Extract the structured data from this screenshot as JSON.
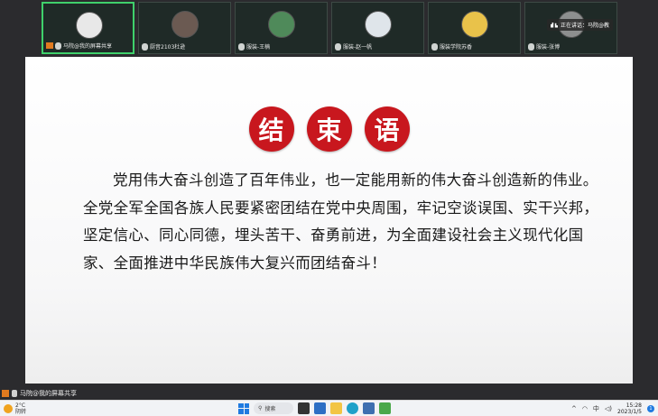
{
  "participants": [
    {
      "name": "马院@我的屏幕共享",
      "speaking": true,
      "avatar_color": "#e8e8e8"
    },
    {
      "name": "厨音2103杜逊",
      "speaking": false,
      "avatar_color": "#6b5a52"
    },
    {
      "name": "服装-王楠",
      "speaking": false,
      "avatar_color": "#4f8a5a"
    },
    {
      "name": "服装-赵一帆",
      "speaking": false,
      "avatar_color": "#dfe5ea"
    },
    {
      "name": "服装学院苏香",
      "speaking": false,
      "avatar_color": "#e9c24a"
    },
    {
      "name": "服装-张博",
      "speaking": false,
      "avatar_color": "#8d8f8f"
    }
  ],
  "speaking_panel": {
    "label": "正在讲话：马院@教"
  },
  "slide": {
    "title_chars": [
      "结",
      "束",
      "语"
    ],
    "body": "党用伟大奋斗创造了百年伟业，也一定能用新的伟大奋斗创造新的伟业。全党全军全国各族人民要紧密团结在党中央周围，牢记空谈误国、实干兴邦，坚定信心、同心同德，埋头苦干、奋勇前进，为全面建设社会主义现代化国家、全面推进中华民族伟大复兴而团结奋斗！"
  },
  "presenter": {
    "label": "马院@我的屏幕共享"
  },
  "taskbar": {
    "weather_temp": "2°C",
    "weather_desc": "阴转",
    "search_label": "搜索",
    "ime_label": "中",
    "time": "15:28",
    "date": "2023/1/5",
    "notification_count": "1"
  },
  "colors": {
    "title_red": "#c8171e",
    "speaking_green": "#3fd06b",
    "windows_blue": "#1f7ae0"
  }
}
